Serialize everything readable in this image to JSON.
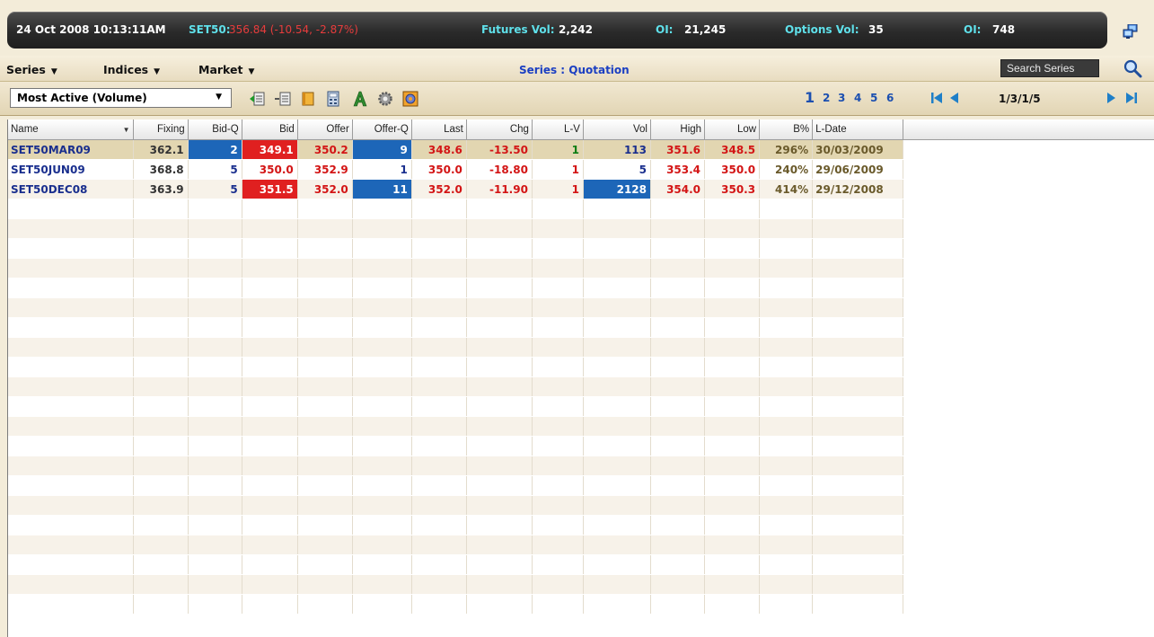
{
  "ticker": {
    "datetime": "24 Oct 2008 10:13:11AM",
    "index_label": "SET50:",
    "index_value": "356.84 (-10.54, -2.87%)",
    "futures_vol_label": "Futures Vol:",
    "futures_vol": "2,242",
    "futures_oi_label": "OI:",
    "futures_oi": "21,245",
    "options_vol_label": "Options Vol:",
    "options_vol": "35",
    "options_oi_label": "OI:",
    "options_oi": "748"
  },
  "menu": {
    "series": "Series",
    "indices": "Indices",
    "market": "Market",
    "title": "Series : Quotation",
    "search_placeholder": "Search Series"
  },
  "toolbar": {
    "filter_value": "Most Active (Volume)",
    "pages": [
      "1",
      "2",
      "3",
      "4",
      "5",
      "6"
    ],
    "page_info": "1/3/1/5"
  },
  "grid": {
    "columns": [
      "Name",
      "Fixing",
      "Bid-Q",
      "Bid",
      "Offer",
      "Offer-Q",
      "Last",
      "Chg",
      "L-V",
      "Vol",
      "High",
      "Low",
      "B%",
      "L-Date"
    ],
    "rows": [
      [
        "SET50MAR09",
        "362.1",
        "2",
        "349.1",
        "350.2",
        "9",
        "348.6",
        "-13.50",
        "1",
        "113",
        "351.6",
        "348.5",
        "296%",
        "30/03/2009"
      ],
      [
        "SET50JUN09",
        "368.8",
        "5",
        "350.0",
        "352.9",
        "1",
        "350.0",
        "-18.80",
        "1",
        "5",
        "353.4",
        "350.0",
        "240%",
        "29/06/2009"
      ],
      [
        "SET50DEC08",
        "363.9",
        "5",
        "351.5",
        "352.0",
        "11",
        "352.0",
        "-11.90",
        "1",
        "2128",
        "354.0",
        "350.3",
        "414%",
        "29/12/2008"
      ]
    ]
  },
  "colors": {
    "ticker_bg": "#2d2d2d",
    "cyan": "#5fe0ea",
    "red": "#d31515",
    "highlight_blue": "#1d66b8",
    "highlight_red": "#e02020",
    "selected_row": "#e2d6b1"
  }
}
